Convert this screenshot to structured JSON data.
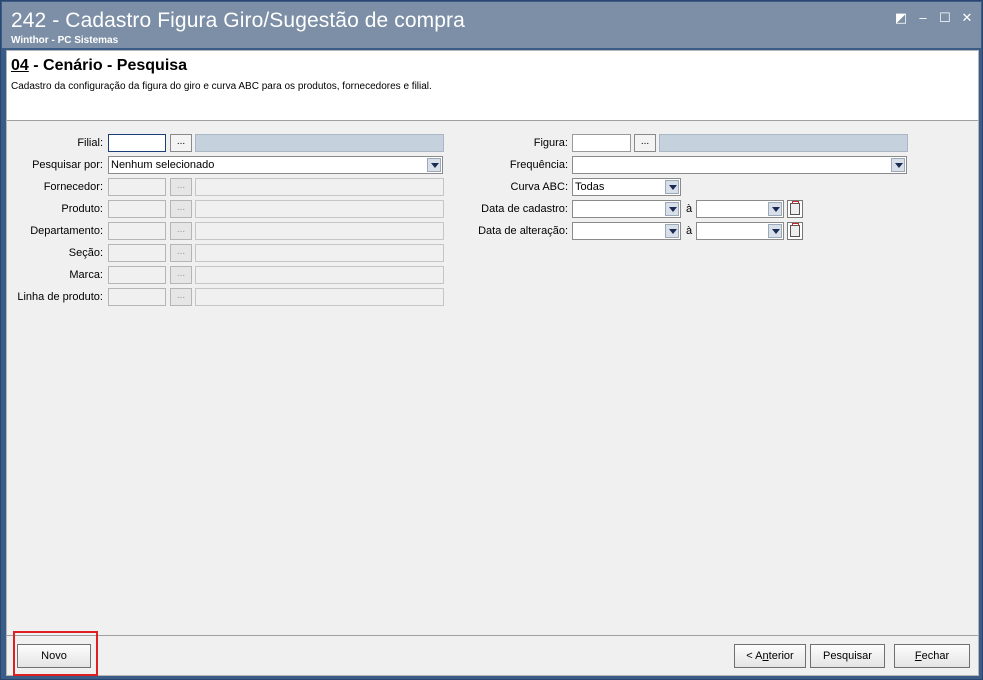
{
  "window": {
    "title": "242 - Cadastro Figura Giro/Sugestão de compra",
    "subtitle": "Winthor - PC Sistemas",
    "buttons": [
      "restore",
      "minimize",
      "maximize",
      "close"
    ]
  },
  "header": {
    "step_number": "04",
    "step_title": " - Cenário - Pesquisa",
    "description": "Cadastro da configuração da figura do giro e curva ABC para os produtos, fornecedores e filial."
  },
  "left_form": {
    "filial_label": "Filial:",
    "pesquisar_por_label": "Pesquisar por:",
    "pesquisar_por_value": "Nenhum selecionado",
    "fornecedor_label": "Fornecedor:",
    "produto_label": "Produto:",
    "departamento_label": "Departamento:",
    "secao_label": "Seção:",
    "marca_label": "Marca:",
    "linha_label": "Linha de produto:",
    "ellipsis": "..."
  },
  "right_form": {
    "figura_label": "Figura:",
    "frequencia_label": "Frequência:",
    "frequencia_value": "",
    "curva_label": "Curva ABC:",
    "curva_value": "Todas",
    "data_cadastro_label": "Data de cadastro:",
    "data_alteracao_label": "Data de alteração:",
    "a_label": "à"
  },
  "footer": {
    "novo": "Novo",
    "anterior_prefix": "< A",
    "anterior_underline": "n",
    "anterior_suffix": "terior",
    "pesquisar": "Pesquisar",
    "fechar_underline": "F",
    "fechar_suffix": "echar"
  },
  "colors": {
    "title_bar": "#7c8fa6",
    "highlight": "#e02020"
  }
}
